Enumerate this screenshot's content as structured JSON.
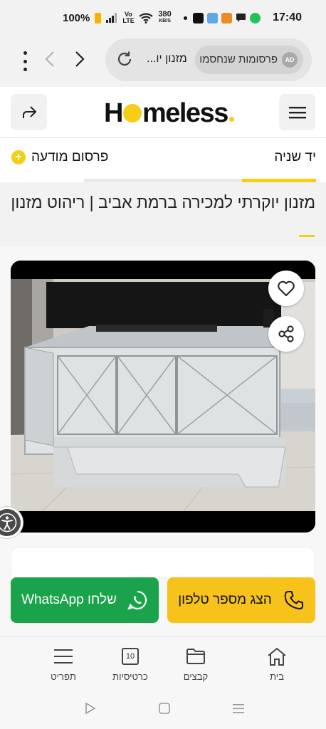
{
  "status": {
    "battery": "100%",
    "lte": "Vo LTE",
    "speed_value": "380",
    "speed_unit": "KB/S",
    "time": "17:40"
  },
  "browser": {
    "url": "מזנון יו...",
    "ad_chip_label": "פרסומות שנחסמו",
    "ad_badge": "AD"
  },
  "header": {
    "logo_pre": "H",
    "logo_post": "meless"
  },
  "nav": {
    "category": "יד שניה",
    "post_ad_label": "פרסום מודעה",
    "post_ad_plus": "+"
  },
  "listing": {
    "title": "מזנון יוקרתי למכירה ברמת אביב | ריהוט מזנון"
  },
  "cta": {
    "whatsapp_label": "שלחו WhatsApp",
    "phone_label": "הצג מספר טלפון"
  },
  "bottom_nav": {
    "items": [
      {
        "label": "בית",
        "icon": "home-icon"
      },
      {
        "label": "קבצים",
        "icon": "folder-icon"
      },
      {
        "label": "כרטיסיות",
        "icon": "tabs-icon",
        "count": "10"
      },
      {
        "label": "תפריט",
        "icon": "menu-icon"
      }
    ]
  },
  "colors": {
    "brand_yellow": "#f7cd17",
    "whatsapp_green": "#1aa34a",
    "phone_yellow": "#f7c21a"
  }
}
